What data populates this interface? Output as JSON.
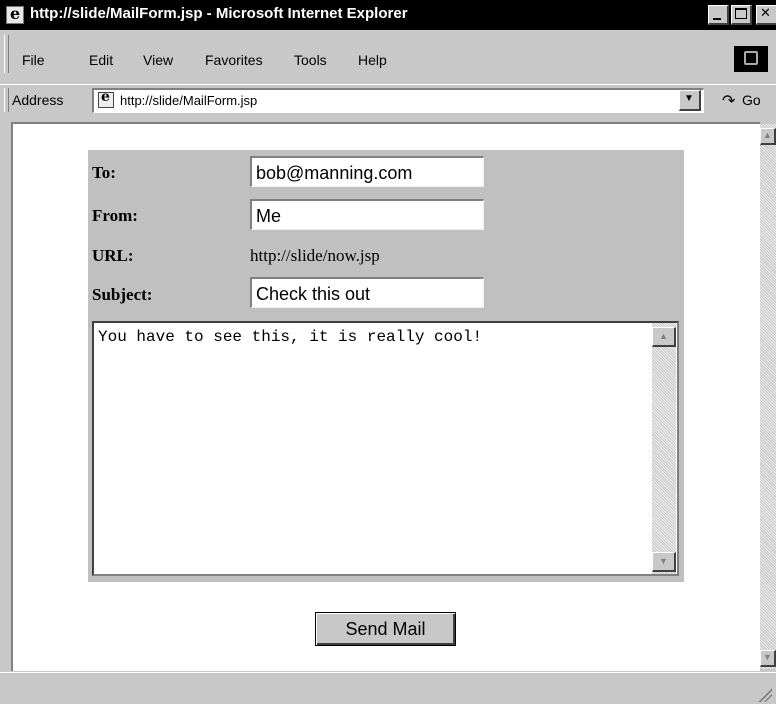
{
  "window": {
    "title": "http://slide/MailForm.jsp - Microsoft Internet Explorer"
  },
  "menu": {
    "items": [
      "File",
      "Edit",
      "View",
      "Favorites",
      "Tools",
      "Help"
    ]
  },
  "address_bar": {
    "label": "Address",
    "url": "http://slide/MailForm.jsp",
    "go_label": "Go"
  },
  "form": {
    "to_label": "To:",
    "to_value": "bob@manning.com",
    "from_label": "From:",
    "from_value": "Me",
    "url_label": "URL:",
    "url_value": "http://slide/now.jsp",
    "subject_label": "Subject:",
    "subject_value": "Check this out",
    "message": "You have to see this, it is really cool!",
    "send_label": "Send Mail"
  }
}
